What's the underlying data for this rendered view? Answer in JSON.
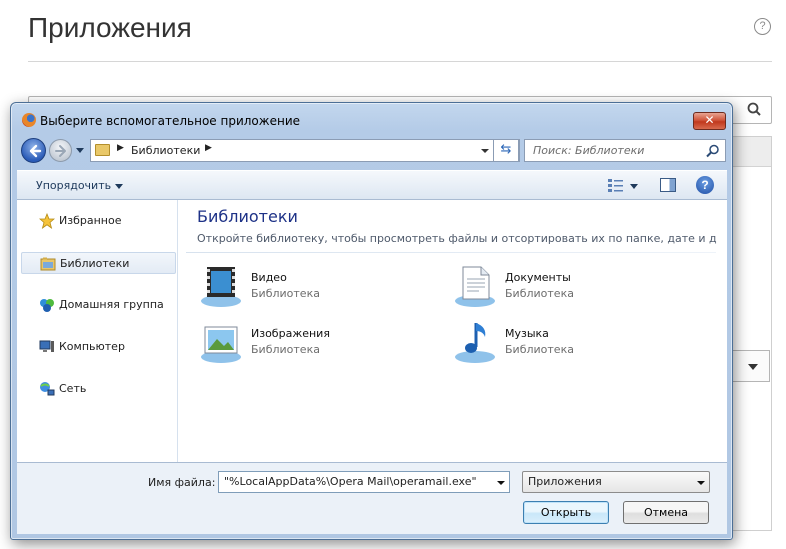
{
  "background": {
    "page_title": "Приложения",
    "help_icon_glyph": "?"
  },
  "dialog": {
    "title": "Выберите вспомогательное приложение",
    "close_glyph": "✕",
    "address": {
      "path_segments": [
        "Библиотеки"
      ]
    },
    "search": {
      "placeholder": "Поиск: Библиотеки"
    },
    "toolbar": {
      "organize_label": "Упорядочить",
      "help_glyph": "?"
    },
    "nav": {
      "items": [
        {
          "label": "Избранное",
          "icon": "star-icon"
        },
        {
          "label": "Библиотеки",
          "icon": "libraries-folder-icon",
          "selected": true
        },
        {
          "label": "Домашняя группа",
          "icon": "homegroup-icon"
        },
        {
          "label": "Компьютер",
          "icon": "computer-icon"
        },
        {
          "label": "Сеть",
          "icon": "network-icon"
        }
      ]
    },
    "content": {
      "heading": "Библиотеки",
      "subheading": "Откройте библиотеку, чтобы просмотреть файлы и отсортировать их по папке, дате и др...",
      "libraries": [
        {
          "name": "Видео",
          "type": "Библиотека",
          "icon": "video-library-icon"
        },
        {
          "name": "Документы",
          "type": "Библиотека",
          "icon": "documents-library-icon"
        },
        {
          "name": "Изображения",
          "type": "Библиотека",
          "icon": "pictures-library-icon"
        },
        {
          "name": "Музыка",
          "type": "Библиотека",
          "icon": "music-library-icon"
        }
      ]
    },
    "footer": {
      "filename_label": "Имя файла:",
      "filename_value": "\"%LocalAppData%\\Opera Mail\\operamail.exe\"",
      "filetype_value": "Приложения",
      "open_label": "Открыть",
      "cancel_label": "Отмена"
    }
  }
}
